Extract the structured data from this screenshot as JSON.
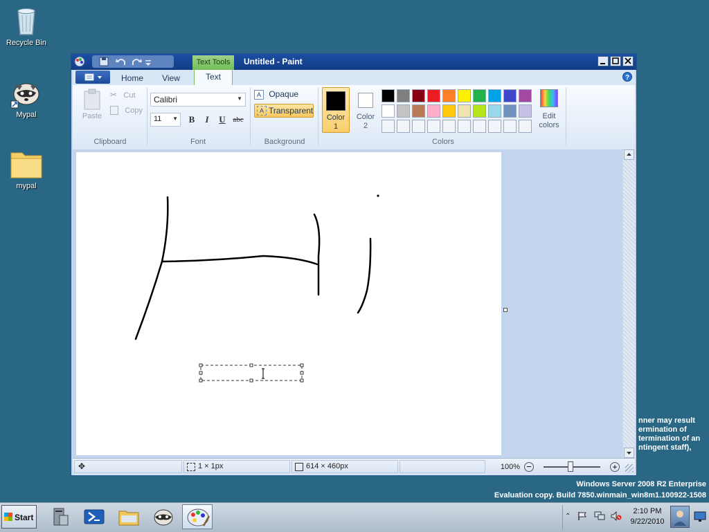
{
  "desktop": {
    "icons": [
      {
        "label": "Recycle Bin",
        "icon": "recycle-bin-icon"
      },
      {
        "label": "Mypal",
        "icon": "raccoon-icon"
      },
      {
        "label": "mypal",
        "icon": "folder-icon"
      }
    ],
    "watermark_text": [
      "nner may result",
      "ermination of",
      "termination of an",
      "ntingent staff),"
    ],
    "os_line1": "Windows Server 2008 R2 Enterprise",
    "os_line2": "Evaluation copy. Build 7850.winmain_win8m1.100922-1508"
  },
  "window": {
    "title": "Untitled - Paint",
    "contextual_tab": "Text Tools",
    "tabs": [
      "Home",
      "View",
      "Text"
    ],
    "active_tab": "Text"
  },
  "ribbon": {
    "clipboard": {
      "paste": "Paste",
      "cut": "Cut",
      "copy": "Copy",
      "label": "Clipboard"
    },
    "font": {
      "family": "Calibri",
      "size": "11",
      "bold": "B",
      "italic": "I",
      "underline": "U",
      "strike": "abc",
      "label": "Font"
    },
    "background": {
      "opaque": "Opaque",
      "transparent": "Transparent",
      "label": "Background"
    },
    "colors": {
      "color1": "Color 1",
      "color2": "Color 2",
      "color1_value": "#000000",
      "color2_value": "#ffffff",
      "edit": "Edit colors",
      "label": "Colors",
      "palette_row1": [
        "#000000",
        "#7f7f7f",
        "#880015",
        "#ed1c24",
        "#ff7f27",
        "#fff200",
        "#22b14c",
        "#00a2e8",
        "#3f48cc",
        "#a349a4"
      ],
      "palette_row2": [
        "#ffffff",
        "#c3c3c3",
        "#b97a57",
        "#ffaec9",
        "#ffc90e",
        "#efe4b0",
        "#b5e61d",
        "#99d9ea",
        "#7092be",
        "#c8bfe7"
      ],
      "palette_row3_count": 10
    }
  },
  "canvas": {
    "drawing": "Hi",
    "cursor": "text-cursor"
  },
  "status": {
    "selection": "1 × 1px",
    "size": "614 × 460px",
    "zoom": "100%",
    "zoom_level_percent": 100
  },
  "taskbar": {
    "start": "Start",
    "time": "2:10 PM",
    "date": "9/22/2010",
    "apps": [
      "server-manager-icon",
      "powershell-icon",
      "explorer-icon",
      "mypal-icon",
      "paint-icon"
    ],
    "active_app": "paint-icon"
  }
}
